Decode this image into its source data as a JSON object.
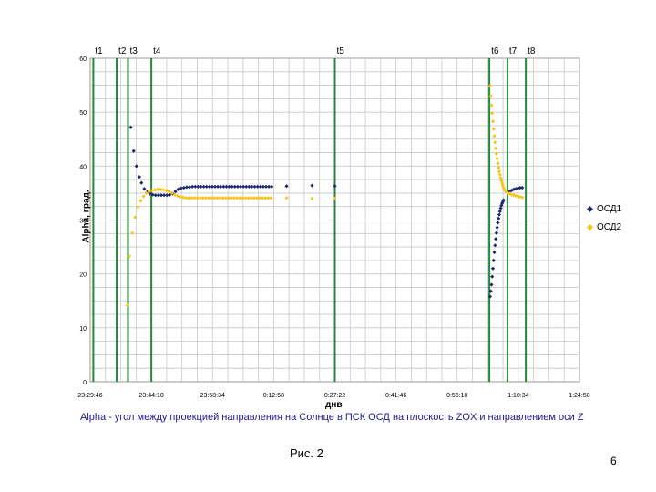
{
  "chart_data": {
    "type": "scatter",
    "xlabel": "днв",
    "ylabel": "Alpha, град.",
    "x_ticks": [
      "23:29:46",
      "23:44:10",
      "23:58:34",
      "0:12:58",
      "0:27:22",
      "0:41:46",
      "0:56:10",
      "1:10:34",
      "1:24:58"
    ],
    "y_ticks": [
      0,
      10,
      20,
      30,
      40,
      50,
      60
    ],
    "xlim": [
      "23:29:46",
      "1:24:58"
    ],
    "ylim": [
      0,
      60
    ],
    "grid": true,
    "legend_position": "right",
    "markers": [
      {
        "label": "t1",
        "time": "23:30:30"
      },
      {
        "label": "t2",
        "time": "23:36:00"
      },
      {
        "label": "t3",
        "time": "23:38:40"
      },
      {
        "label": "t4",
        "time": "23:44:10"
      },
      {
        "label": "t5",
        "time": "0:27:22"
      },
      {
        "label": "t6",
        "time": "1:03:45"
      },
      {
        "label": "t7",
        "time": "1:08:00"
      },
      {
        "label": "t8",
        "time": "1:12:20"
      }
    ],
    "series": [
      {
        "name": "ОСД1",
        "color": "#1f2a6e",
        "points": [
          [
            "23:39:20",
            47.2
          ],
          [
            "23:40:00",
            42.8
          ],
          [
            "23:40:40",
            40.0
          ],
          [
            "23:41:20",
            38.0
          ],
          [
            "23:41:50",
            36.9
          ],
          [
            "23:42:30",
            35.8
          ],
          [
            "23:43:10",
            35.2
          ],
          [
            "23:43:50",
            34.9
          ],
          [
            "23:44:30",
            34.7
          ],
          [
            "23:45:10",
            34.6
          ],
          [
            "23:45:50",
            34.6
          ],
          [
            "23:46:30",
            34.6
          ],
          [
            "23:47:10",
            34.6
          ],
          [
            "23:47:50",
            34.6
          ],
          [
            "23:48:30",
            34.7
          ],
          [
            "23:49:10",
            34.9
          ],
          [
            "23:49:50",
            35.3
          ],
          [
            "23:50:30",
            35.7
          ],
          [
            "23:51:10",
            35.9
          ],
          [
            "23:51:50",
            36.0
          ],
          [
            "23:52:30",
            36.1
          ],
          [
            "23:53:10",
            36.1
          ],
          [
            "23:53:50",
            36.2
          ],
          [
            "23:54:30",
            36.2
          ],
          [
            "23:55:10",
            36.2
          ],
          [
            "23:55:50",
            36.2
          ],
          [
            "23:56:30",
            36.2
          ],
          [
            "23:57:10",
            36.2
          ],
          [
            "23:57:50",
            36.2
          ],
          [
            "23:58:30",
            36.2
          ],
          [
            "23:59:10",
            36.2
          ],
          [
            "23:59:50",
            36.2
          ],
          [
            "0:00:30",
            36.2
          ],
          [
            "0:01:10",
            36.2
          ],
          [
            "0:01:50",
            36.2
          ],
          [
            "0:02:30",
            36.2
          ],
          [
            "0:03:10",
            36.2
          ],
          [
            "0:03:50",
            36.2
          ],
          [
            "0:04:30",
            36.2
          ],
          [
            "0:05:10",
            36.2
          ],
          [
            "0:05:50",
            36.2
          ],
          [
            "0:06:30",
            36.2
          ],
          [
            "0:07:10",
            36.2
          ],
          [
            "0:07:50",
            36.2
          ],
          [
            "0:08:30",
            36.2
          ],
          [
            "0:09:10",
            36.2
          ],
          [
            "0:09:50",
            36.2
          ],
          [
            "0:10:30",
            36.2
          ],
          [
            "0:11:10",
            36.2
          ],
          [
            "0:11:50",
            36.2
          ],
          [
            "0:12:30",
            36.2
          ],
          [
            "0:16:00",
            36.3
          ],
          [
            "0:22:00",
            36.4
          ],
          [
            "0:27:22",
            36.3
          ],
          [
            "1:03:55",
            15.8
          ],
          [
            "1:04:05",
            16.8
          ],
          [
            "1:04:15",
            18.0
          ],
          [
            "1:04:25",
            19.5
          ],
          [
            "1:04:35",
            21.0
          ],
          [
            "1:04:45",
            22.5
          ],
          [
            "1:04:55",
            24.0
          ],
          [
            "1:05:05",
            25.3
          ],
          [
            "1:05:15",
            26.5
          ],
          [
            "1:05:25",
            27.6
          ],
          [
            "1:05:35",
            28.6
          ],
          [
            "1:05:45",
            29.5
          ],
          [
            "1:05:55",
            30.3
          ],
          [
            "1:06:05",
            31.0
          ],
          [
            "1:06:15",
            31.6
          ],
          [
            "1:06:25",
            32.2
          ],
          [
            "1:06:35",
            32.7
          ],
          [
            "1:06:45",
            33.1
          ],
          [
            "1:06:55",
            33.4
          ],
          [
            "1:07:05",
            33.7
          ],
          [
            "1:08:30",
            35.3
          ],
          [
            "1:09:00",
            35.5
          ],
          [
            "1:09:30",
            35.7
          ],
          [
            "1:10:00",
            35.8
          ],
          [
            "1:10:30",
            35.9
          ],
          [
            "1:11:00",
            36.0
          ],
          [
            "1:11:30",
            36.0
          ]
        ]
      },
      {
        "name": "ОСД2",
        "color": "#f5c518",
        "points": [
          [
            "23:38:30",
            14.2
          ],
          [
            "23:39:00",
            23.3
          ],
          [
            "23:39:40",
            27.6
          ],
          [
            "23:40:20",
            30.5
          ],
          [
            "23:41:00",
            32.4
          ],
          [
            "23:41:40",
            33.6
          ],
          [
            "23:42:20",
            34.4
          ],
          [
            "23:43:00",
            35.0
          ],
          [
            "23:43:40",
            35.3
          ],
          [
            "23:44:20",
            35.5
          ],
          [
            "23:45:00",
            35.6
          ],
          [
            "23:45:40",
            35.7
          ],
          [
            "23:46:20",
            35.7
          ],
          [
            "23:47:00",
            35.6
          ],
          [
            "23:47:40",
            35.5
          ],
          [
            "23:48:20",
            35.3
          ],
          [
            "23:49:00",
            35.0
          ],
          [
            "23:49:40",
            34.7
          ],
          [
            "23:50:20",
            34.5
          ],
          [
            "23:51:00",
            34.3
          ],
          [
            "23:51:40",
            34.2
          ],
          [
            "23:52:20",
            34.1
          ],
          [
            "23:53:00",
            34.1
          ],
          [
            "23:53:40",
            34.1
          ],
          [
            "23:54:20",
            34.1
          ],
          [
            "23:55:00",
            34.1
          ],
          [
            "23:55:40",
            34.1
          ],
          [
            "23:56:20",
            34.1
          ],
          [
            "23:57:00",
            34.1
          ],
          [
            "23:57:40",
            34.1
          ],
          [
            "23:58:20",
            34.1
          ],
          [
            "23:59:00",
            34.1
          ],
          [
            "23:59:40",
            34.1
          ],
          [
            "0:00:20",
            34.1
          ],
          [
            "0:01:00",
            34.1
          ],
          [
            "0:01:40",
            34.1
          ],
          [
            "0:02:20",
            34.1
          ],
          [
            "0:03:00",
            34.1
          ],
          [
            "0:03:40",
            34.1
          ],
          [
            "0:04:20",
            34.1
          ],
          [
            "0:05:00",
            34.1
          ],
          [
            "0:05:40",
            34.1
          ],
          [
            "0:06:20",
            34.1
          ],
          [
            "0:07:00",
            34.1
          ],
          [
            "0:07:40",
            34.1
          ],
          [
            "0:08:20",
            34.1
          ],
          [
            "0:09:00",
            34.1
          ],
          [
            "0:09:40",
            34.1
          ],
          [
            "0:10:20",
            34.1
          ],
          [
            "0:11:00",
            34.1
          ],
          [
            "0:11:40",
            34.1
          ],
          [
            "0:12:20",
            34.1
          ],
          [
            "0:16:00",
            34.1
          ],
          [
            "0:22:00",
            34.0
          ],
          [
            "0:27:22",
            34.0
          ],
          [
            "1:03:55",
            54.8
          ],
          [
            "1:04:05",
            53.0
          ],
          [
            "1:04:15",
            51.3
          ],
          [
            "1:04:25",
            49.8
          ],
          [
            "1:04:35",
            48.3
          ],
          [
            "1:04:45",
            46.9
          ],
          [
            "1:04:55",
            45.6
          ],
          [
            "1:05:05",
            44.4
          ],
          [
            "1:05:15",
            43.3
          ],
          [
            "1:05:25",
            42.3
          ],
          [
            "1:05:35",
            41.4
          ],
          [
            "1:05:45",
            40.5
          ],
          [
            "1:05:55",
            39.7
          ],
          [
            "1:06:05",
            39.0
          ],
          [
            "1:06:15",
            38.4
          ],
          [
            "1:06:25",
            37.8
          ],
          [
            "1:06:35",
            37.3
          ],
          [
            "1:06:45",
            36.8
          ],
          [
            "1:06:55",
            36.4
          ],
          [
            "1:07:05",
            36.0
          ],
          [
            "1:07:15",
            35.7
          ],
          [
            "1:07:30",
            35.4
          ],
          [
            "1:08:00",
            35.1
          ],
          [
            "1:08:30",
            34.9
          ],
          [
            "1:09:00",
            34.7
          ],
          [
            "1:09:30",
            34.6
          ],
          [
            "1:10:00",
            34.5
          ],
          [
            "1:10:30",
            34.4
          ],
          [
            "1:11:00",
            34.3
          ],
          [
            "1:11:30",
            34.2
          ]
        ]
      }
    ]
  },
  "caption": "Alpha - угол между проекцией направления на Солнце в ПСК ОСД на плоскость  ZOX  и направлением оси  Z",
  "figure_label": "Рис. 2",
  "page_number": "6"
}
